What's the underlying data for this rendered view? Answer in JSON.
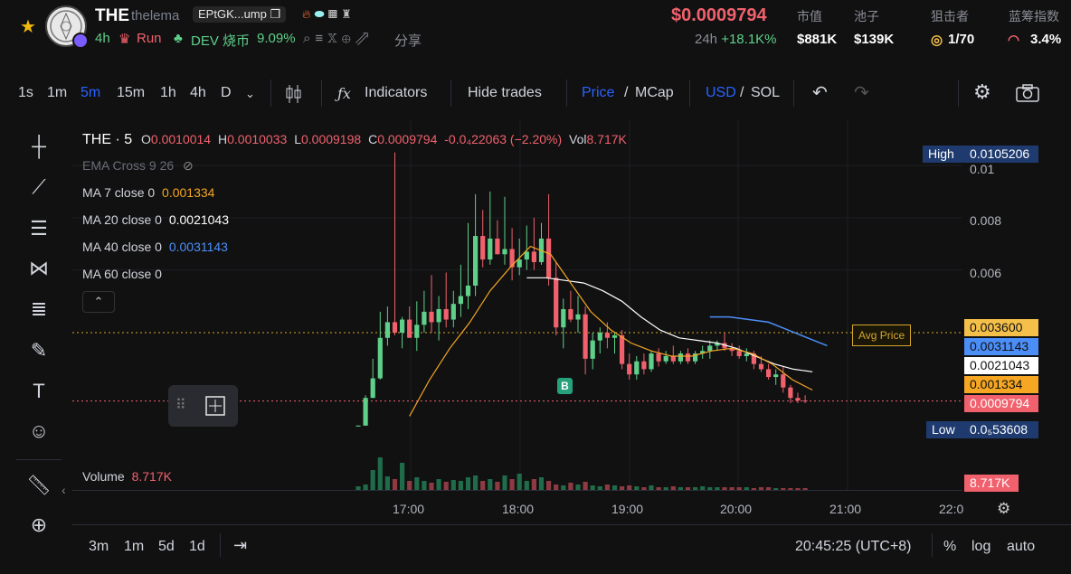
{
  "token": {
    "symbol": "THE",
    "name": "thelema",
    "address": "EPtGK...ump",
    "age": "4h",
    "run_label": "Run",
    "dev_label": "DEV 烧币",
    "dev_pct": "9.09%",
    "share_label": "分享"
  },
  "price": {
    "value": "$0.0009794",
    "period": "24h",
    "change": "+18.1K%"
  },
  "stats": [
    {
      "label": "市值",
      "value": "$881K"
    },
    {
      "label": "池子",
      "value": "$139K"
    },
    {
      "label": "狙击者",
      "value": "1/70"
    },
    {
      "label": "蓝筹指数",
      "value": "3.4%"
    }
  ],
  "toolbar": {
    "timeframes": [
      "1s",
      "1m",
      "5m",
      "15m",
      "1h",
      "4h",
      "D"
    ],
    "active_timeframe": "5m",
    "indicators_label": "Indicators",
    "hide_trades_label": "Hide trades",
    "price_label": "Price",
    "mcap_label": "MCap",
    "usd_label": "USD",
    "sol_label": "SOL"
  },
  "legend": {
    "symbol": "THE · 5",
    "o_label": "O",
    "o": "0.0010014",
    "h_label": "H",
    "h": "0.0010033",
    "l_label": "L",
    "l": "0.0009198",
    "c_label": "C",
    "c": "0.0009794",
    "change": "-0.0₄22063 (−2.20%)",
    "vol_label": "Vol",
    "vol": "8.717K",
    "ema_label": "EMA Cross 9 26",
    "ma7_label": "MA 7 close 0",
    "ma7": "0.001334",
    "ma20_label": "MA 20 close 0",
    "ma20": "0.0021043",
    "ma40_label": "MA 40 close 0",
    "ma40": "0.0031143",
    "ma60_label": "MA 60 close 0",
    "volume_label": "Volume",
    "volume": "8.717K"
  },
  "price_axis": {
    "high_label": "High",
    "high": "0.0105206",
    "low_label": "Low",
    "low": "0.0₅53608",
    "ticks": [
      "0.01",
      "0.008",
      "0.006"
    ],
    "avg_price_label": "Avg Price",
    "markers": [
      {
        "value": "0.003600",
        "color": "#f5c04a",
        "text_color": "#111111"
      },
      {
        "value": "0.0031143",
        "color": "#4c8ef7",
        "text_color": "#111111"
      },
      {
        "value": "0.0021043",
        "color": "#ffffff",
        "text_color": "#111111"
      },
      {
        "value": "0.001334",
        "color": "#f5a623",
        "text_color": "#111111"
      },
      {
        "value": "0.0009794",
        "color": "#f0616d",
        "text_color": "#ffffff"
      }
    ],
    "volume_marker": "8.717K"
  },
  "time_axis": [
    "17:00",
    "18:00",
    "19:00",
    "20:00",
    "21:00",
    "22:0"
  ],
  "trade_marker": "B",
  "bottom": {
    "ranges": [
      "3m",
      "1m",
      "5d",
      "1d"
    ],
    "clock": "20:45:25 (UTC+8)",
    "pct_label": "%",
    "log_label": "log",
    "auto_label": "auto"
  },
  "colors": {
    "up": "#5fd08a",
    "down": "#f0616d",
    "accent": "#2962ff",
    "ma7": "#f5a623",
    "ma20": "#ffffff",
    "ma40": "#4c8ef7"
  },
  "chart_data": {
    "type": "candlestick",
    "interval": "5m",
    "ylim": [
      0,
      0.0105206
    ],
    "candles": [
      {
        "o": 3e-05,
        "h": 5e-05,
        "l": 3e-05,
        "c": 4e-05
      },
      {
        "o": 4e-05,
        "h": 0.0012,
        "l": 4e-05,
        "c": 0.0011
      },
      {
        "o": 0.0011,
        "h": 0.0026,
        "l": 0.0011,
        "c": 0.00185
      },
      {
        "o": 0.00185,
        "h": 0.0044,
        "l": 0.0018,
        "c": 0.0034
      },
      {
        "o": 0.0034,
        "h": 0.0046,
        "l": 0.0031,
        "c": 0.004
      },
      {
        "o": 0.004,
        "h": 0.0105,
        "l": 0.0035,
        "c": 0.0036
      },
      {
        "o": 0.0036,
        "h": 0.0042,
        "l": 0.003,
        "c": 0.0041
      },
      {
        "o": 0.0041,
        "h": 0.0046,
        "l": 0.0034,
        "c": 0.0034
      },
      {
        "o": 0.0034,
        "h": 0.0048,
        "l": 0.0029,
        "c": 0.0039
      },
      {
        "o": 0.0039,
        "h": 0.0052,
        "l": 0.0036,
        "c": 0.0044
      },
      {
        "o": 0.0044,
        "h": 0.0058,
        "l": 0.0036,
        "c": 0.004
      },
      {
        "o": 0.004,
        "h": 0.005,
        "l": 0.0033,
        "c": 0.0045
      },
      {
        "o": 0.0045,
        "h": 0.0059,
        "l": 0.0038,
        "c": 0.0041
      },
      {
        "o": 0.0041,
        "h": 0.0052,
        "l": 0.0038,
        "c": 0.0047
      },
      {
        "o": 0.0047,
        "h": 0.0062,
        "l": 0.0042,
        "c": 0.005
      },
      {
        "o": 0.005,
        "h": 0.0078,
        "l": 0.0045,
        "c": 0.0054
      },
      {
        "o": 0.0054,
        "h": 0.0089,
        "l": 0.005,
        "c": 0.0073
      },
      {
        "o": 0.0073,
        "h": 0.0083,
        "l": 0.0061,
        "c": 0.0064
      },
      {
        "o": 0.0064,
        "h": 0.009,
        "l": 0.0062,
        "c": 0.0072
      },
      {
        "o": 0.0072,
        "h": 0.0079,
        "l": 0.0066,
        "c": 0.0066
      },
      {
        "o": 0.0066,
        "h": 0.0088,
        "l": 0.0062,
        "c": 0.0068
      },
      {
        "o": 0.0068,
        "h": 0.0076,
        "l": 0.0056,
        "c": 0.0061
      },
      {
        "o": 0.0061,
        "h": 0.0072,
        "l": 0.0058,
        "c": 0.0064
      },
      {
        "o": 0.0064,
        "h": 0.0077,
        "l": 0.006,
        "c": 0.0067
      },
      {
        "o": 0.0067,
        "h": 0.008,
        "l": 0.006,
        "c": 0.0063
      },
      {
        "o": 0.0063,
        "h": 0.0078,
        "l": 0.0062,
        "c": 0.0072
      },
      {
        "o": 0.0072,
        "h": 0.0089,
        "l": 0.0054,
        "c": 0.0057
      },
      {
        "o": 0.0057,
        "h": 0.0063,
        "l": 0.0035,
        "c": 0.0038
      },
      {
        "o": 0.0038,
        "h": 0.0049,
        "l": 0.003,
        "c": 0.0045
      },
      {
        "o": 0.0045,
        "h": 0.0052,
        "l": 0.004,
        "c": 0.0041
      },
      {
        "o": 0.0041,
        "h": 0.005,
        "l": 0.0036,
        "c": 0.0043
      },
      {
        "o": 0.0043,
        "h": 0.0046,
        "l": 0.002,
        "c": 0.0026
      },
      {
        "o": 0.0026,
        "h": 0.0036,
        "l": 0.0022,
        "c": 0.0033
      },
      {
        "o": 0.0033,
        "h": 0.0038,
        "l": 0.0028,
        "c": 0.0036
      },
      {
        "o": 0.0036,
        "h": 0.004,
        "l": 0.003,
        "c": 0.0034
      },
      {
        "o": 0.0034,
        "h": 0.0036,
        "l": 0.0028,
        "c": 0.0035
      },
      {
        "o": 0.0035,
        "h": 0.0037,
        "l": 0.0022,
        "c": 0.0024
      },
      {
        "o": 0.0024,
        "h": 0.0028,
        "l": 0.0018,
        "c": 0.002
      },
      {
        "o": 0.002,
        "h": 0.0027,
        "l": 0.0018,
        "c": 0.0025
      },
      {
        "o": 0.0025,
        "h": 0.0028,
        "l": 0.002,
        "c": 0.0022
      },
      {
        "o": 0.0022,
        "h": 0.0029,
        "l": 0.0021,
        "c": 0.0028
      },
      {
        "o": 0.0028,
        "h": 0.003,
        "l": 0.0023,
        "c": 0.0025
      },
      {
        "o": 0.0025,
        "h": 0.0029,
        "l": 0.0024,
        "c": 0.0027
      },
      {
        "o": 0.0027,
        "h": 0.0031,
        "l": 0.0024,
        "c": 0.0025
      },
      {
        "o": 0.0025,
        "h": 0.0029,
        "l": 0.0024,
        "c": 0.0028
      },
      {
        "o": 0.0028,
        "h": 0.003,
        "l": 0.0024,
        "c": 0.0025
      },
      {
        "o": 0.0025,
        "h": 0.0029,
        "l": 0.0024,
        "c": 0.0028
      },
      {
        "o": 0.0028,
        "h": 0.0031,
        "l": 0.0026,
        "c": 0.0029
      },
      {
        "o": 0.0029,
        "h": 0.0033,
        "l": 0.0026,
        "c": 0.0031
      },
      {
        "o": 0.0031,
        "h": 0.0033,
        "l": 0.0029,
        "c": 0.0032
      },
      {
        "o": 0.0032,
        "h": 0.0036,
        "l": 0.0029,
        "c": 0.003
      },
      {
        "o": 0.003,
        "h": 0.0032,
        "l": 0.0027,
        "c": 0.0029
      },
      {
        "o": 0.0029,
        "h": 0.0031,
        "l": 0.0026,
        "c": 0.0027
      },
      {
        "o": 0.0027,
        "h": 0.003,
        "l": 0.0025,
        "c": 0.0028
      },
      {
        "o": 0.0028,
        "h": 0.0029,
        "l": 0.0022,
        "c": 0.0024
      },
      {
        "o": 0.0024,
        "h": 0.0027,
        "l": 0.0021,
        "c": 0.0022
      },
      {
        "o": 0.0022,
        "h": 0.0024,
        "l": 0.0018,
        "c": 0.0019
      },
      {
        "o": 0.0019,
        "h": 0.0022,
        "l": 0.0016,
        "c": 0.002
      },
      {
        "o": 0.002,
        "h": 0.0023,
        "l": 0.0013,
        "c": 0.0015
      },
      {
        "o": 0.0015,
        "h": 0.0016,
        "l": 0.0009,
        "c": 0.0011
      },
      {
        "o": 0.0011,
        "h": 0.0013,
        "l": 0.0009,
        "c": 0.001
      },
      {
        "o": 0.001,
        "h": 0.0012,
        "l": 0.0009,
        "c": 0.00098
      }
    ],
    "volume": [
      4,
      6,
      22,
      36,
      15,
      12,
      30,
      10,
      14,
      10,
      8,
      12,
      9,
      11,
      10,
      14,
      16,
      10,
      12,
      9,
      16,
      12,
      18,
      10,
      12,
      14,
      10,
      6,
      5,
      8,
      6,
      9,
      5,
      4,
      6,
      5,
      4,
      5,
      4,
      3,
      5,
      3,
      3,
      4,
      3,
      3,
      3,
      4,
      3,
      3,
      3,
      3,
      3,
      3,
      2,
      3,
      3,
      2,
      2,
      2,
      2,
      2
    ],
    "ma7_trend": [
      0.0004,
      0.0018,
      0.003,
      0.004,
      0.0052,
      0.0061,
      0.0069,
      0.0066,
      0.0055,
      0.0044,
      0.0037,
      0.0032,
      0.0029,
      0.0027,
      0.0027,
      0.0029,
      0.003,
      0.0028,
      0.0024,
      0.0018,
      0.0014
    ],
    "ma20_trend": [
      0.0057,
      0.0057,
      0.0056,
      0.0055,
      0.0052,
      0.0048,
      0.0042,
      0.0037,
      0.0034,
      0.0033,
      0.0032,
      0.003,
      0.0027,
      0.0024,
      0.0022,
      0.0021
    ],
    "ma40_trend": [
      0.0042,
      0.0042,
      0.0041,
      0.004,
      0.0037,
      0.0034,
      0.0031
    ]
  }
}
